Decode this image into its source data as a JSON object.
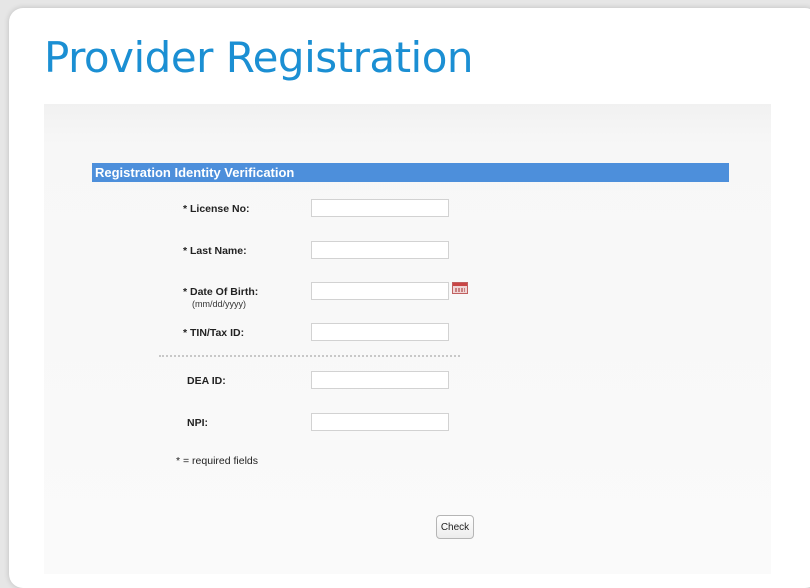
{
  "page": {
    "title": "Provider Registration"
  },
  "form": {
    "section_title": "Registration Identity Verification",
    "fields": [
      {
        "label": "* License No:",
        "value": "",
        "placeholder": ""
      },
      {
        "label": "* Last Name:",
        "value": "",
        "placeholder": ""
      },
      {
        "label": "* Date Of Birth:",
        "hint": "(mm/dd/yyyy)",
        "value": "",
        "placeholder": ""
      },
      {
        "label": "* TIN/Tax ID:",
        "value": "",
        "placeholder": ""
      }
    ],
    "optional_fields": [
      {
        "label": "DEA ID:",
        "value": "",
        "placeholder": ""
      },
      {
        "label": "NPI:",
        "value": "",
        "placeholder": ""
      }
    ],
    "required_note": "* = required fields",
    "check_label": "Check"
  },
  "icons": {
    "date_picker": "calendar-icon"
  },
  "colors": {
    "title": "#1b8fd3",
    "section_bar": "#4d8fdb",
    "calendar_icon": "#c94545"
  }
}
